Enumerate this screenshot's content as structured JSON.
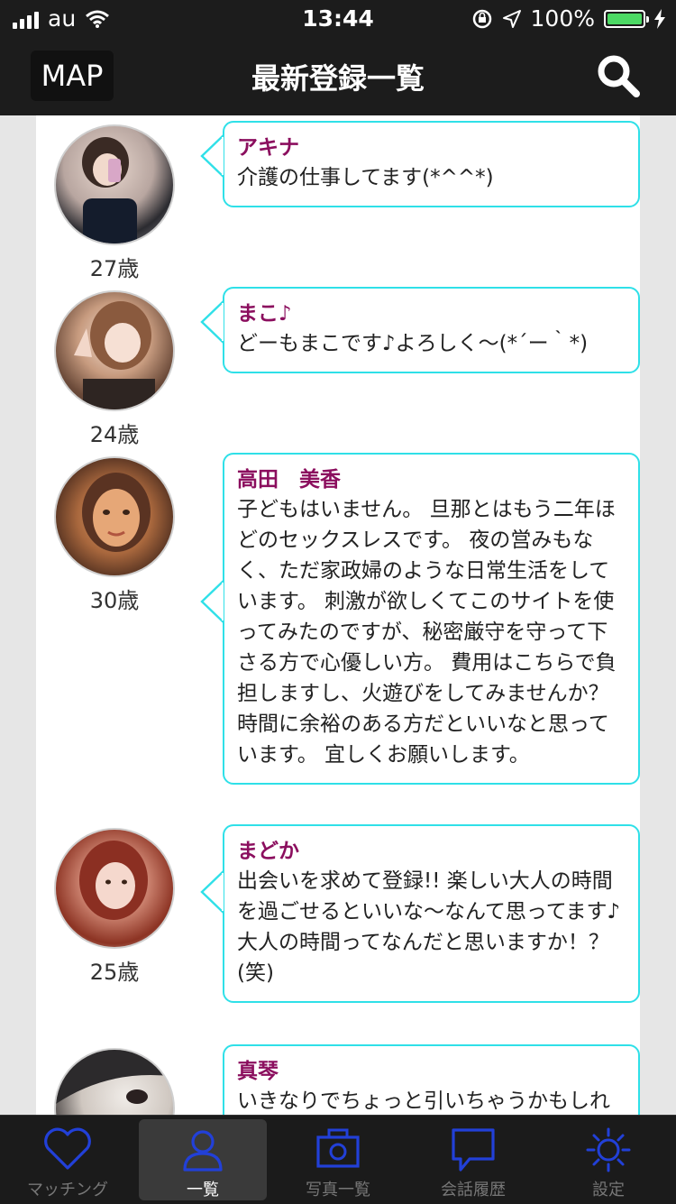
{
  "status": {
    "carrier": "au",
    "time": "13:44",
    "battery": "100%",
    "battery_level": 1.0
  },
  "nav": {
    "map_label": "MAP",
    "title": "最新登録一覧"
  },
  "entries": [
    {
      "name": "アキナ",
      "message": "介護の仕事してます(*^^*)",
      "age": "27歳"
    },
    {
      "name": "まこ♪",
      "message": "どーもまこです♪よろしく〜(*´ー｀*)",
      "age": "24歳"
    },
    {
      "name": "高田　美香",
      "message": "子どもはいません。 旦那とはもう二年ほどのセックスレスです。 夜の営みもなく、ただ家政婦のような日常生活をしています。 刺激が欲しくてこのサイトを使ってみたのですが、秘密厳守を守って下さる方で心優しい方。 費用はこちらで負担しますし、火遊びをしてみませんか？ 時間に余裕のある方だといいなと思っています。 宜しくお願いします。",
      "age": "30歳"
    },
    {
      "name": "まどか",
      "message": "出会いを求めて登録!! 楽しい大人の時間を過ごせるといいな〜なんて思ってます♪ 大人の時間ってなんだと思いますか！？(笑)",
      "age": "25歳"
    },
    {
      "name": "真琴",
      "message": "いきなりでちょっと引いちゃうかもしれ",
      "age": ""
    }
  ],
  "tabs": [
    {
      "label": "マッチング",
      "icon": "heart-icon",
      "active": false
    },
    {
      "label": "一覧",
      "icon": "person-icon",
      "active": true
    },
    {
      "label": "写真一覧",
      "icon": "camera-icon",
      "active": false
    },
    {
      "label": "会話履歴",
      "icon": "chat-bubble-icon",
      "active": false
    },
    {
      "label": "設定",
      "icon": "sun-gear-icon",
      "active": false
    }
  ],
  "colors": {
    "accent_blue": "#2240d8",
    "bubble_border": "#2fe0e8",
    "name_color": "#8b0e5e",
    "battery_green": "#4cd964"
  }
}
